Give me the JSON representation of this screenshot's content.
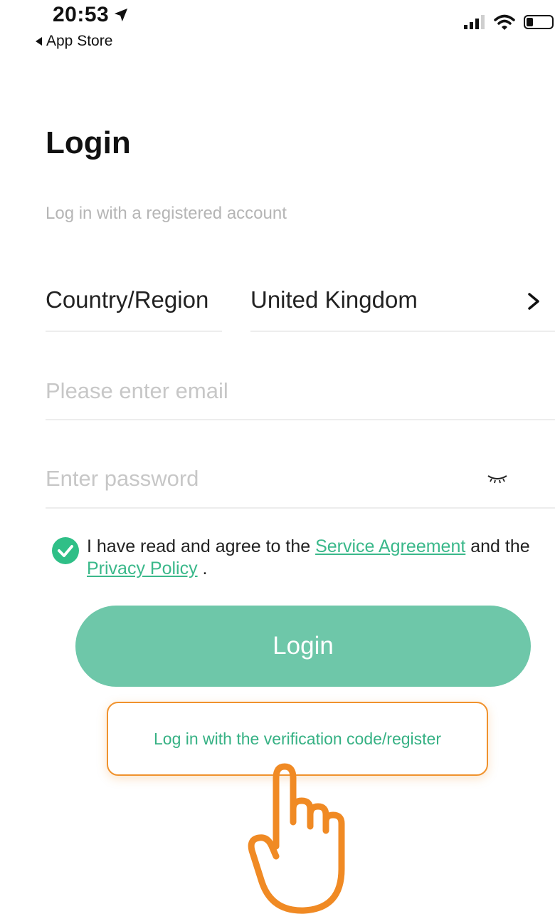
{
  "status_bar": {
    "time": "20:53",
    "back_label": "App Store"
  },
  "header": {
    "title": "Login",
    "subtitle": "Log in with a registered account"
  },
  "country": {
    "label": "Country/Region",
    "value": "United Kingdom"
  },
  "email": {
    "placeholder": "Please enter email",
    "value": ""
  },
  "password": {
    "placeholder": "Enter password",
    "value": ""
  },
  "agreement": {
    "checked": true,
    "prefix": "I have read and agree to the ",
    "service_link": "Service Agreement",
    "middle": " and the ",
    "privacy_link": "Privacy Policy",
    "suffix": "."
  },
  "login_button": "Login",
  "verification_link": "Log in with the verification code/register",
  "colors": {
    "accent": "#6ec7a9",
    "link": "#3ab88a",
    "highlight": "#f0922d"
  },
  "icons": [
    "location-arrow-icon",
    "back-triangle-icon",
    "signal-icon",
    "wifi-icon",
    "battery-icon",
    "chevron-right-icon",
    "eye-closed-icon",
    "checkmark-icon",
    "pointing-hand-icon"
  ]
}
